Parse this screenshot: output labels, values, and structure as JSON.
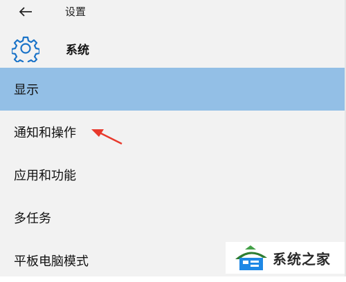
{
  "header": {
    "title": "设置",
    "back_icon": "back-arrow-icon"
  },
  "section": {
    "icon": "gear-icon",
    "title": "系统"
  },
  "nav": {
    "items": [
      {
        "label": "显示",
        "selected": true
      },
      {
        "label": "通知和操作",
        "selected": false
      },
      {
        "label": "应用和功能",
        "selected": false
      },
      {
        "label": "多任务",
        "selected": false
      },
      {
        "label": "平板电脑模式",
        "selected": false
      }
    ]
  },
  "annotation": {
    "icon": "red-arrow-icon",
    "color": "#e8392c"
  },
  "watermark": {
    "text": "系统之家",
    "icon": "house-logo-icon"
  },
  "colors": {
    "accent": "#1a73c8",
    "selected_bg": "#93bfe6",
    "page_bg": "#f2f2f2"
  }
}
